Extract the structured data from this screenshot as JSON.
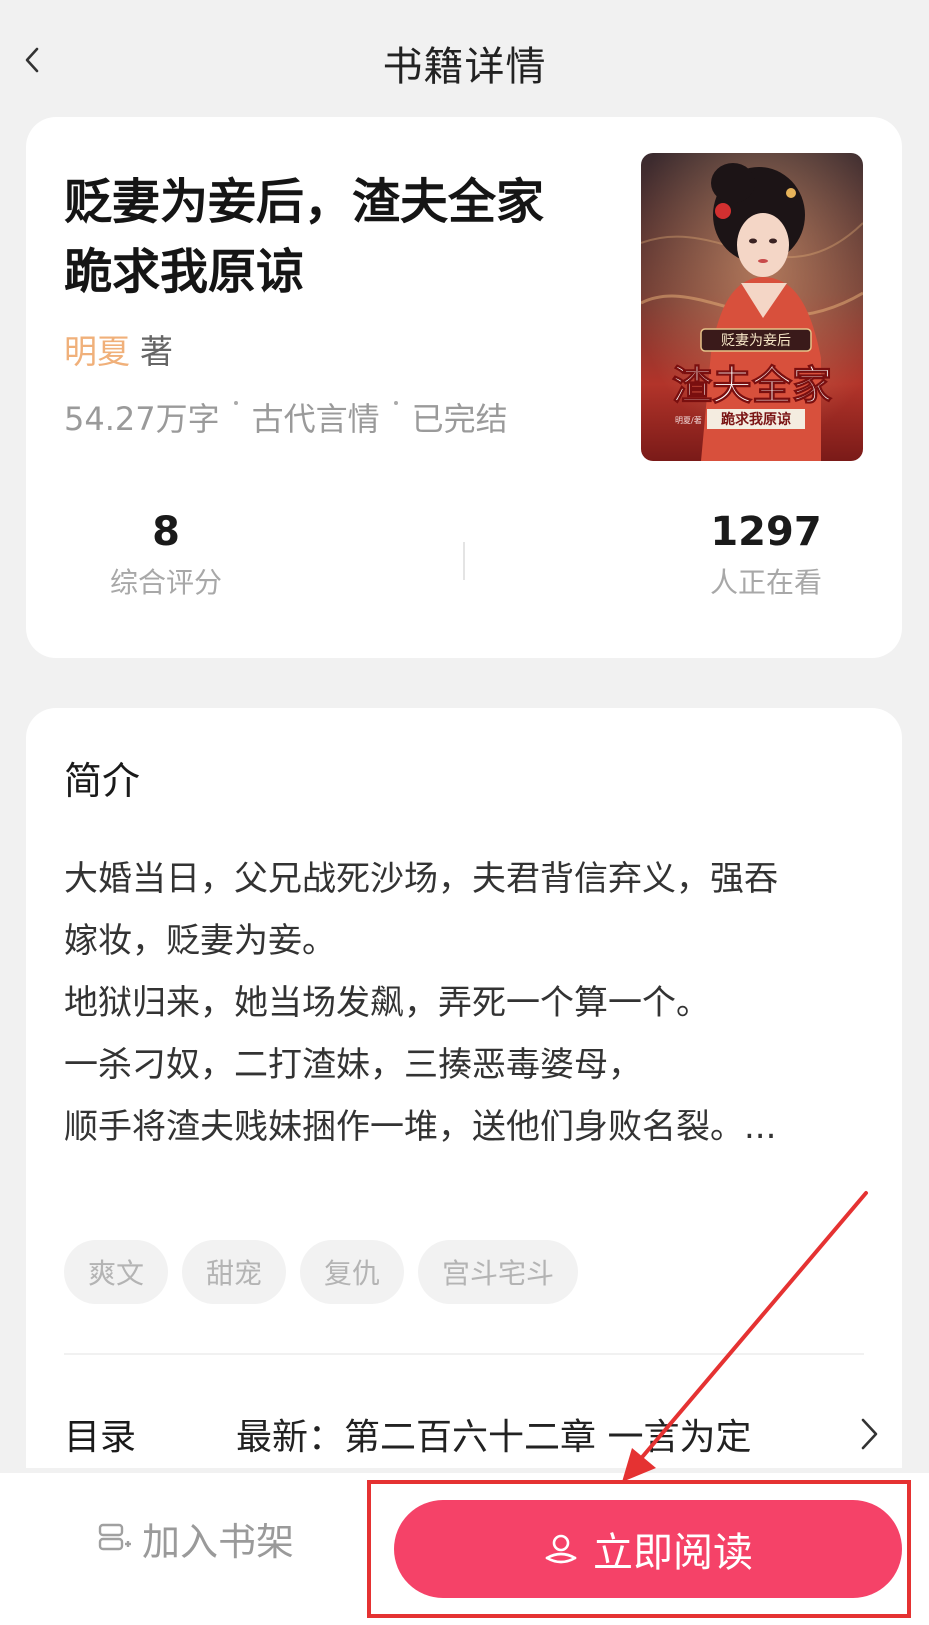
{
  "header": {
    "title": "书籍详情"
  },
  "book": {
    "title_line1": "贬妻为妾后，渣夫全家",
    "title_line2": "跪求我原谅",
    "author": "明夏",
    "author_suffix": "著",
    "word_count": "54.27万字",
    "category": "古代言情",
    "status": "已完结",
    "cover": {
      "top_text": "贬妻为妾后",
      "main_text": "渣夫全家",
      "sub_text": "跪求我原谅",
      "author_mark": "明夏/著"
    }
  },
  "stats": {
    "score_value": "8",
    "score_label": "综合评分",
    "watching_value": "1297",
    "watching_label": "人正在看"
  },
  "intro": {
    "heading": "简介",
    "lines": [
      "大婚当日，父兄战死沙场，夫君背信弃义，强吞",
      "嫁妆，贬妻为妾。",
      "地狱归来，她当场发飙，弄死一个算一个。",
      "一杀刁奴，二打渣妹，三揍恶毒婆母，",
      "顺手将渣夫贱妹捆作一堆，送他们身败名裂。..."
    ],
    "tags": [
      "爽文",
      "甜宠",
      "复仇",
      "宫斗宅斗"
    ]
  },
  "toc": {
    "label": "目录",
    "latest": "最新：第二百六十二章 一言为定"
  },
  "bottom": {
    "shelf_label": "加入书架",
    "read_label": "立即阅读"
  },
  "colors": {
    "accent": "#f54268",
    "author": "#f0b07a",
    "annotation": "#e53232"
  }
}
